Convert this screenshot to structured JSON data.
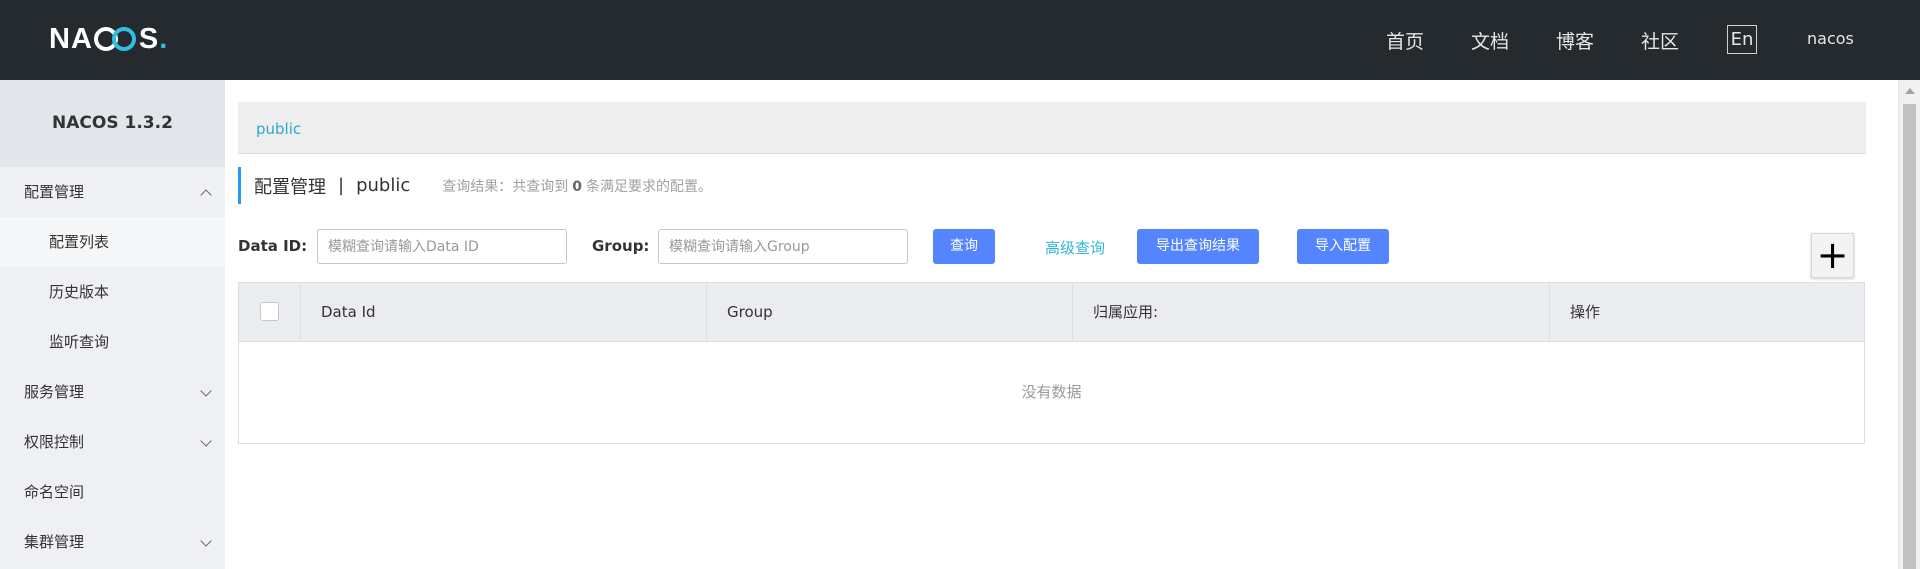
{
  "header": {
    "logo": {
      "left": "NA",
      "right": "S",
      "dot": "."
    },
    "nav": [
      "首页",
      "文档",
      "博客",
      "社区"
    ],
    "lang": "En",
    "user": "nacos"
  },
  "sidebar": {
    "title": "NACOS 1.3.2",
    "items": [
      {
        "label": "配置管理",
        "type": "group",
        "expanded": true
      },
      {
        "label": "配置列表",
        "type": "sub",
        "active": true
      },
      {
        "label": "历史版本",
        "type": "sub"
      },
      {
        "label": "监听查询",
        "type": "sub"
      },
      {
        "label": "服务管理",
        "type": "group"
      },
      {
        "label": "权限控制",
        "type": "group"
      },
      {
        "label": "命名空间",
        "type": "leaf"
      },
      {
        "label": "集群管理",
        "type": "group"
      }
    ]
  },
  "namespace": {
    "current": "public"
  },
  "page": {
    "title": "配置管理",
    "sep": "|",
    "namespace": "public",
    "result_prefix": "查询结果：共查询到",
    "result_count": "0",
    "result_suffix": "条满足要求的配置。"
  },
  "filters": {
    "data_id_label": "Data ID:",
    "data_id_placeholder": "模糊查询请输入Data ID",
    "data_id_value": "",
    "group_label": "Group:",
    "group_placeholder": "模糊查询请输入Group",
    "group_value": "",
    "query_button": "查询",
    "advanced_link": "高级查询",
    "export_button": "导出查询结果",
    "import_button": "导入配置",
    "add_button": "+"
  },
  "table": {
    "columns": [
      "Data Id",
      "Group",
      "归属应用:",
      "操作"
    ],
    "rows": [],
    "empty_text": "没有数据"
  },
  "colors": {
    "header_bg": "#252a2f",
    "primary": "#5584ff",
    "link": "#2fb8d8",
    "accent": "#209bfa"
  }
}
